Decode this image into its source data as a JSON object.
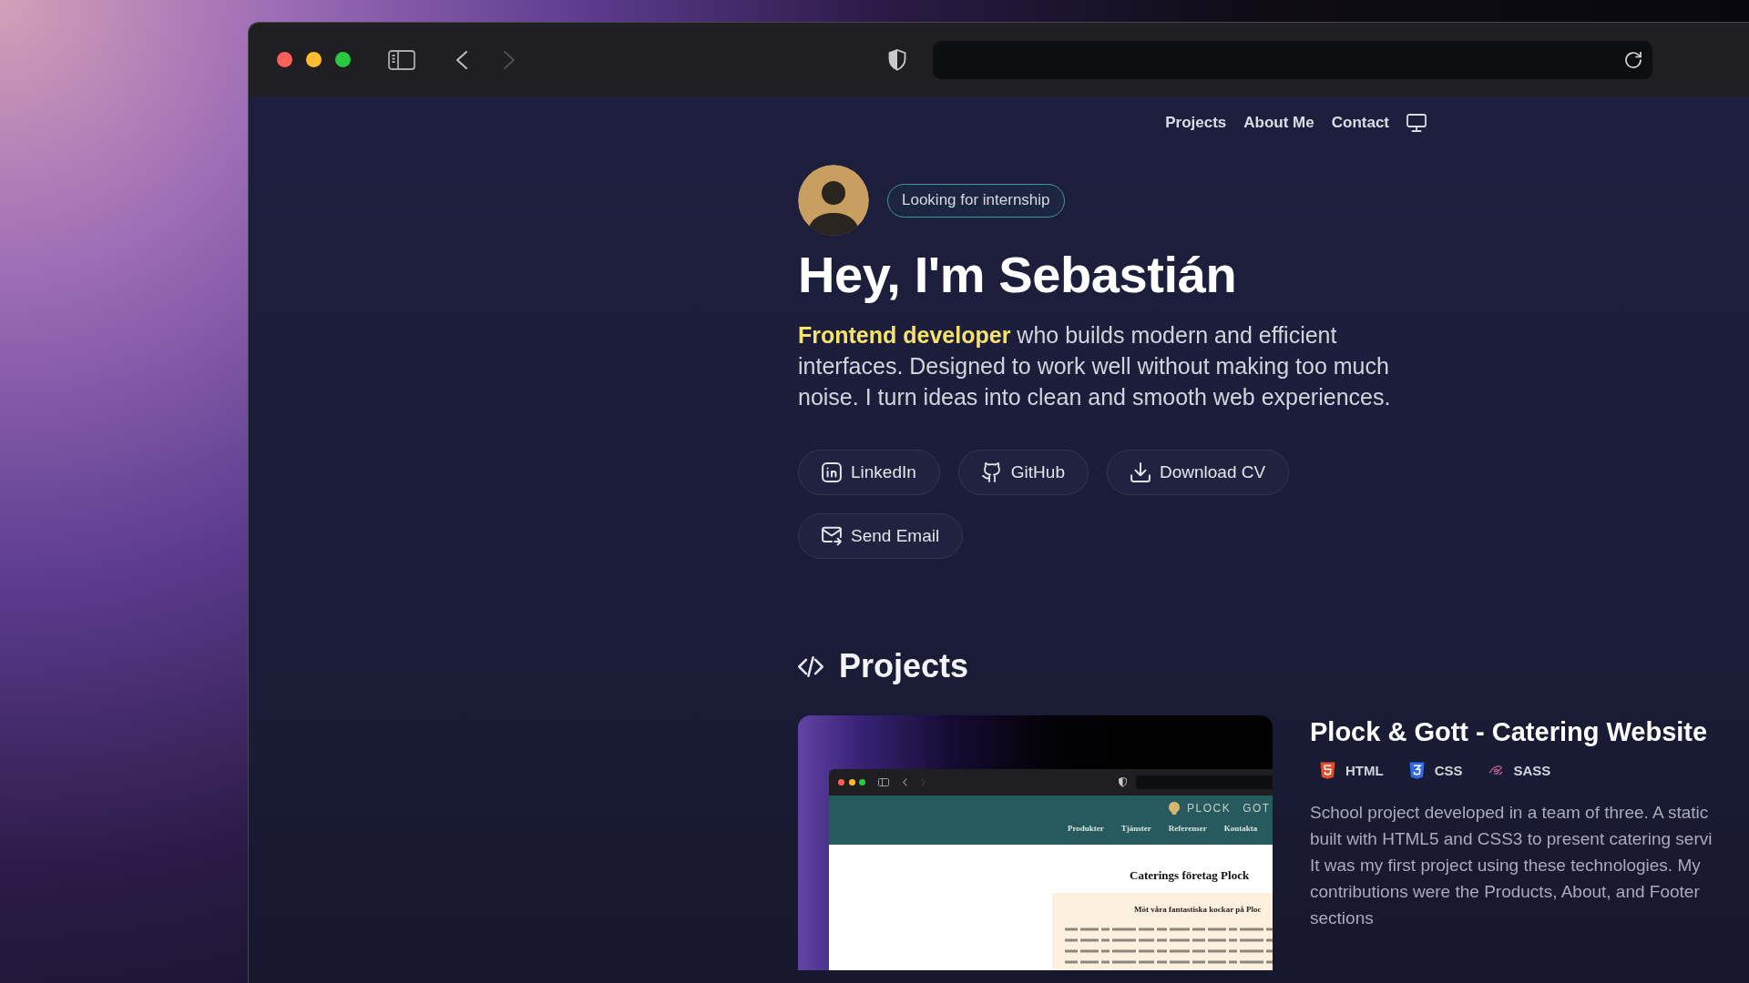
{
  "browser": {
    "back_button": {
      "disabled": false
    },
    "forward_button": {
      "disabled": true
    }
  },
  "nav": {
    "links": [
      "Projects",
      "About Me",
      "Contact"
    ]
  },
  "hero": {
    "badge": "Looking for internship",
    "title": "Hey, I'm Sebastián",
    "intro": "**Frontend developer** who builds modern and efficient interfaces. Designed to work well without making too much noise. I turn ideas into clean and smooth web experiences.",
    "buttons": [
      {
        "kind": "linkedin",
        "label": "LinkedIn"
      },
      {
        "kind": "github",
        "label": "GitHub"
      },
      {
        "kind": "download",
        "label": "Download CV"
      },
      {
        "kind": "email",
        "label": "Send Email"
      }
    ]
  },
  "projects": {
    "heading": "Projects",
    "items": [
      {
        "title": "Plock & Gott - Catering Website",
        "tags": [
          {
            "kind": "html",
            "label": "HTML"
          },
          {
            "kind": "css",
            "label": "CSS"
          },
          {
            "kind": "sass",
            "label": "SASS"
          }
        ],
        "description_lines": [
          "School project developed in a team of three. A static",
          "built with HTML5 and CSS3 to present catering servi",
          "It was my first project using these technologies. My",
          "contributions were the Products, About, and Footer",
          "sections"
        ],
        "thumbnail": {
          "logo": [
            "PLOCK",
            "GOT"
          ],
          "nav": [
            "Produkter",
            "Tjänster",
            "Referenser",
            "Kontakta"
          ],
          "heading": "Caterings företag Plock",
          "subheading": "Möt våra fantastiska kockar på Ploc"
        }
      }
    ]
  }
}
